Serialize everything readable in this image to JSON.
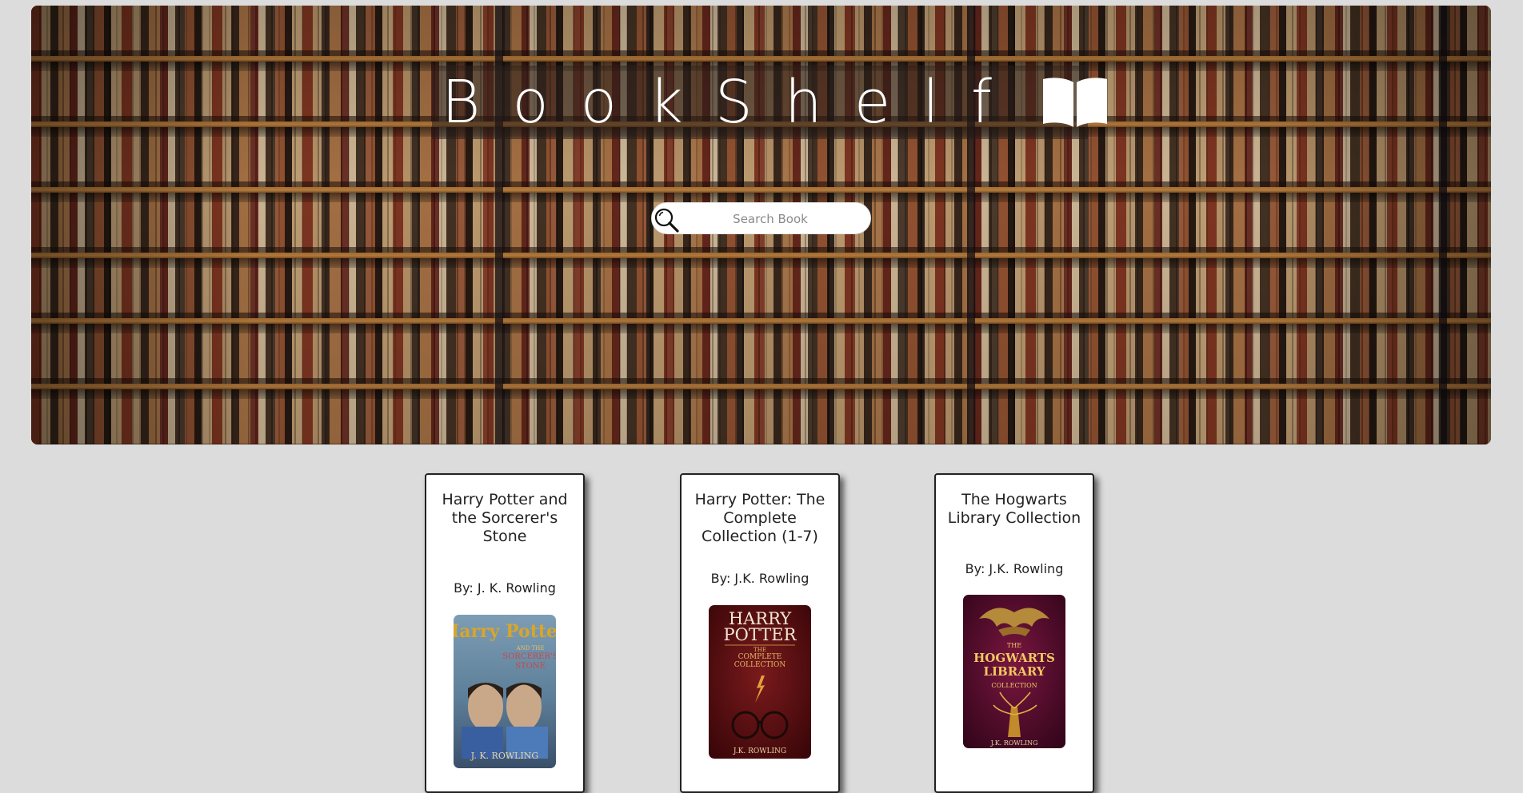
{
  "header": {
    "title": "BookShelf",
    "title_icon": "open-book-icon"
  },
  "search": {
    "placeholder": "Search Book",
    "value": "",
    "icon": "search-icon"
  },
  "books": [
    {
      "title": "Harry Potter and the Sorcerer's Stone",
      "author": "By: J. K. Rowling",
      "cover": {
        "title_line1": "Harry Potter",
        "subtitle_line1": "AND THE",
        "subtitle_line2": "SORCERER'S",
        "subtitle_line3": "STONE",
        "author": "J. K. ROWLING",
        "colors": [
          "#6b8ca6",
          "#c79a3a",
          "#2c3e58"
        ]
      }
    },
    {
      "title": "Harry Potter: The Complete Collection (1-7)",
      "author": "By: J.K. Rowling",
      "cover": {
        "title_line1": "HARRY",
        "title_line2": "POTTER",
        "subtitle_line1": "THE",
        "subtitle_line2": "COMPLETE",
        "subtitle_line3": "COLLECTION",
        "author": "J.K. ROWLING",
        "colors": [
          "#5c0f12",
          "#3a0609",
          "#d8b24a"
        ]
      }
    },
    {
      "title": "The Hogwarts Library Collection",
      "author": "By: J.K. Rowling",
      "cover": {
        "title_line1": "THE",
        "title_line2": "HOGWARTS",
        "title_line3": "LIBRARY",
        "subtitle_line1": "COLLECTION",
        "author": "J.K. ROWLING",
        "colors": [
          "#5a0e2e",
          "#3a0620",
          "#e0b044"
        ]
      }
    }
  ]
}
